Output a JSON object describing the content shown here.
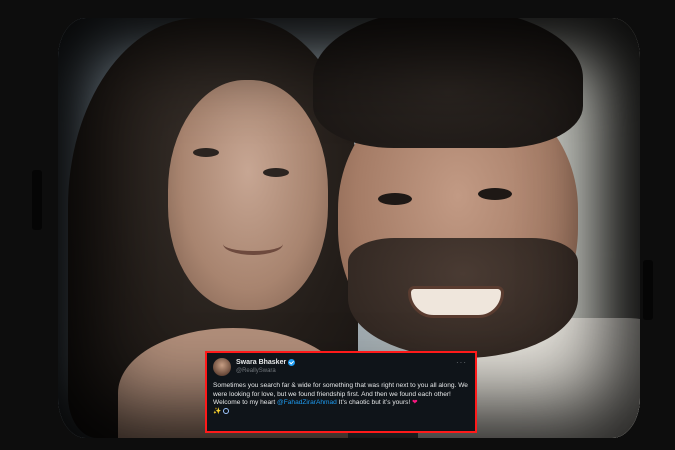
{
  "tweet": {
    "display_name": "Swara Bhasker",
    "handle": "@ReallySwara",
    "more_label": "···",
    "line1": "Sometimes you search far & wide for something that was right next to you all along. We were looking for love, but we found friendship first. And then we found each other!",
    "line2_prefix": "Welcome to my heart ",
    "mention": "@FahadZirarAhmad",
    "line2_suffix": " It’s chaotic but it’s yours! ",
    "heart": "❤",
    "sparkle": "✨",
    "border_color": "#ff1a1a",
    "accent_color": "#1d9bf0"
  },
  "icons": [
    "verified-icon",
    "more-icon",
    "heart-icon",
    "sparkle-icon",
    "dizzy-icon"
  ]
}
